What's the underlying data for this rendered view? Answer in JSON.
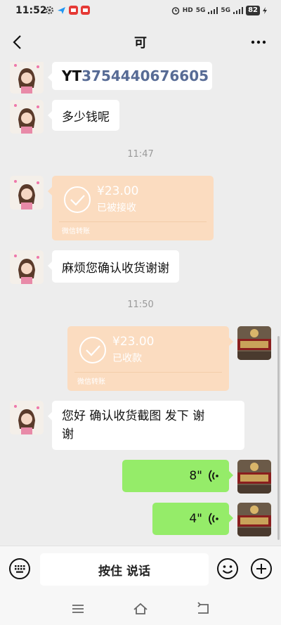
{
  "status_bar": {
    "time": "11:52",
    "battery": "82",
    "network_1": "5G",
    "network_2": "5G",
    "hd_label": "HD"
  },
  "header": {
    "title": "可"
  },
  "messages": {
    "m1_text": "YT3754440676605",
    "m1_prefix": "YT",
    "m1_number": "3754440676605",
    "m2_text": "多少钱呢",
    "time_1": "11:47",
    "transfer_1": {
      "amount": "¥23.00",
      "status": "已被接收",
      "label": "微信转账"
    },
    "m3_text": "麻烦您确认收货谢谢",
    "time_2": "11:50",
    "transfer_2": {
      "amount": "¥23.00",
      "status": "已收款",
      "label": "微信转账"
    },
    "m4_line1": "您好  确认收货截图  发下  谢",
    "m4_line2": "谢",
    "voice_1_duration": "8\"",
    "voice_2_duration": "4\""
  },
  "input_bar": {
    "hold_to_talk": "按住 说话"
  },
  "colors": {
    "background": "#ededed",
    "bubble_self": "#95ec69",
    "transfer_bg": "#fbdcc0",
    "tracking_number": "#576b95"
  }
}
